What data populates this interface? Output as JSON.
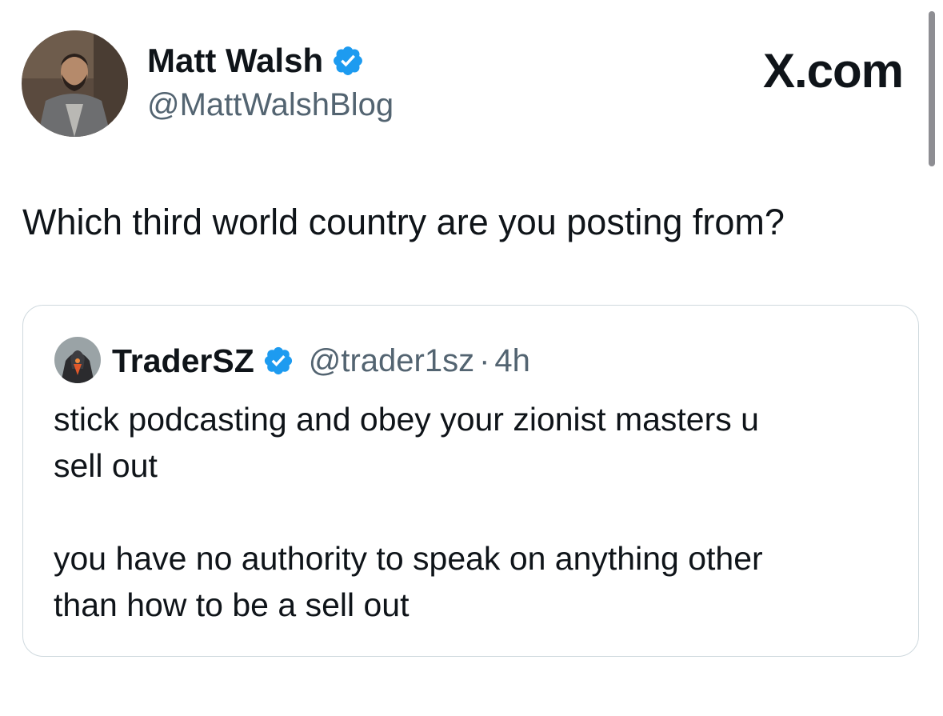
{
  "tweet": {
    "author_name": "Matt Walsh",
    "author_handle": "@MattWalshBlog",
    "site_label": "X.com",
    "text": "Which third world country are you posting from?"
  },
  "quote": {
    "author_name": "TraderSZ",
    "author_handle": "@trader1sz",
    "separator": "·",
    "time": "4h",
    "lines": [
      "stick podcasting and obey your zionist masters u",
      "sell out",
      "you have no authority to speak on anything other",
      "than how to be a sell out"
    ]
  },
  "icons": {
    "verified": "verified-badge-icon"
  },
  "colors": {
    "verified_blue": "#1d9bf0",
    "text_primary": "#0f1419",
    "text_secondary": "#536471",
    "border": "#cfd9de"
  }
}
